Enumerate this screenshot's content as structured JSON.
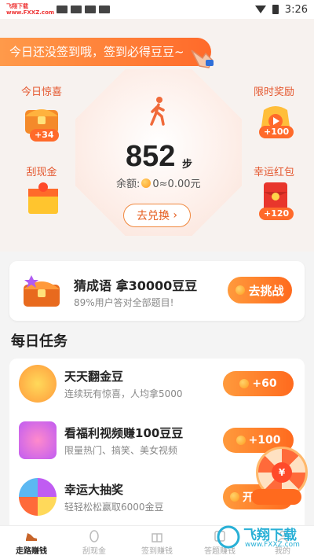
{
  "status_bar": {
    "watermark": "飞翔下载 www.FXXZ.com",
    "time": "3:26"
  },
  "banner": {
    "text": "今日还没签到哦，签到必得豆豆~"
  },
  "steps": {
    "count": "852",
    "unit": "步",
    "balance_label": "余额:",
    "balance_value": "0≈0.00元",
    "exchange_button": "去兑换"
  },
  "side_items": {
    "surprise": {
      "label": "今日惊喜",
      "badge": "+34"
    },
    "scratch": {
      "label": "刮现金"
    },
    "time_reward": {
      "label": "限时奖励",
      "badge": "+100"
    },
    "lucky_red": {
      "label": "幸运红包",
      "badge": "+120"
    }
  },
  "idiom_card": {
    "title": "猜成语 拿30000豆豆",
    "subtitle": "89%用户答对全部题目!",
    "button": "去挑战"
  },
  "daily_tasks": {
    "title": "每日任务",
    "items": [
      {
        "title": "天天翻金豆",
        "subtitle": "连续玩有惊喜，人均拿5000",
        "button": "+60"
      },
      {
        "title": "看福利视频赚100豆豆",
        "subtitle": "限量热门、搞笑、美女视频",
        "button": "+100"
      },
      {
        "title": "幸运大抽奖",
        "subtitle": "轻轻松松赢取6000金豆",
        "button": "开启宝箱"
      }
    ]
  },
  "treasure": {
    "center": "¥"
  },
  "bottom_nav": [
    {
      "label": "走路赚钱"
    },
    {
      "label": "刮现金"
    },
    {
      "label": "签到赚钱"
    },
    {
      "label": "答题赚钱"
    },
    {
      "label": "我的"
    }
  ],
  "watermark": {
    "text": "飞翔下载",
    "url": "www.FXXZ.com"
  },
  "colors": {
    "accent": "#ff6a1e",
    "accent_light": "#ff9a3c"
  }
}
